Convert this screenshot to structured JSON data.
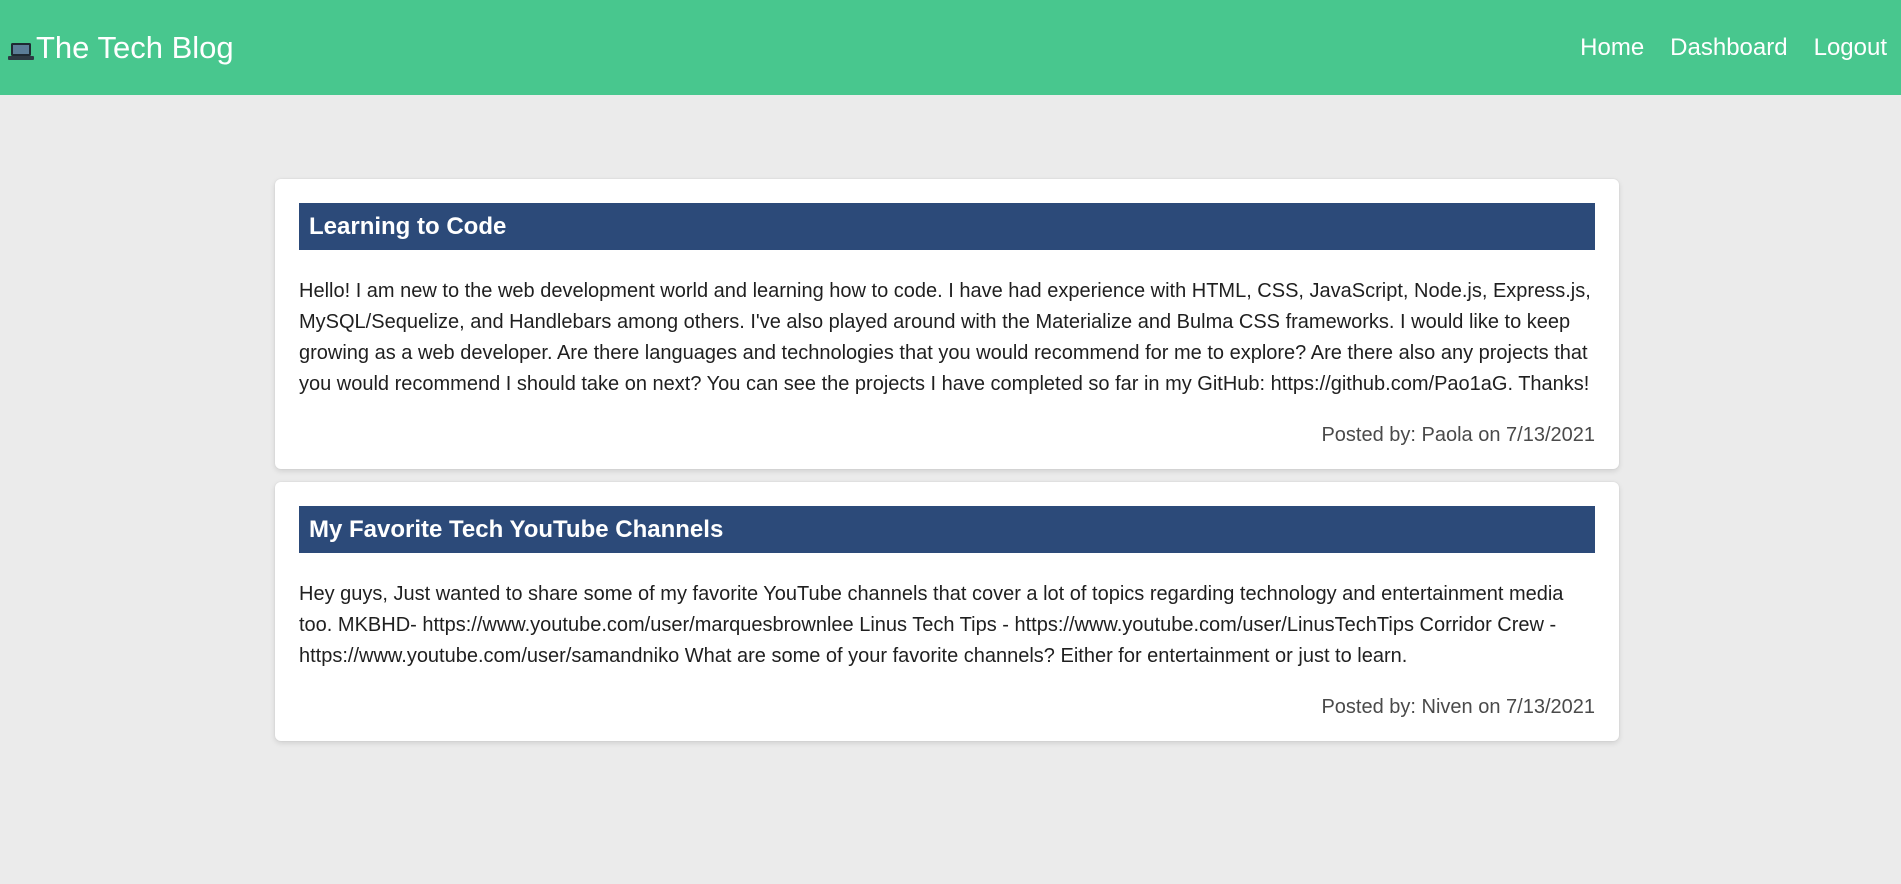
{
  "navbar": {
    "brand_icon": "laptop-icon",
    "brand_title": "The Tech Blog",
    "background_color": "#48c78e",
    "links": [
      {
        "label": "Home"
      },
      {
        "label": "Dashboard"
      },
      {
        "label": "Logout"
      }
    ]
  },
  "posts": [
    {
      "title": "Learning to Code",
      "body": "Hello! I am new to the web development world and learning how to code. I have had experience with HTML, CSS, JavaScript, Node.js, Express.js, MySQL/Sequelize, and Handlebars among others. I've also played around with the Materialize and Bulma CSS frameworks. I would like to keep growing as a web developer. Are there languages and technologies that you would recommend for me to explore? Are there also any projects that you would recommend I should take on next? You can see the projects I have completed so far in my GitHub: https://github.com/Pao1aG. Thanks!",
      "footer": "Posted by: Paola on 7/13/2021"
    },
    {
      "title": "My Favorite Tech YouTube Channels",
      "body": "Hey guys, Just wanted to share some of my favorite YouTube channels that cover a lot of topics regarding technology and entertainment media too. MKBHD- https://www.youtube.com/user/marquesbrownlee Linus Tech Tips - https://www.youtube.com/user/LinusTechTips Corridor Crew - https://www.youtube.com/user/samandniko What are some of your favorite channels? Either for entertainment or just to learn.",
      "footer": "Posted by: Niven on 7/13/2021"
    }
  ],
  "colors": {
    "page_background": "#ebebeb",
    "title_bar": "#2c4a79"
  }
}
